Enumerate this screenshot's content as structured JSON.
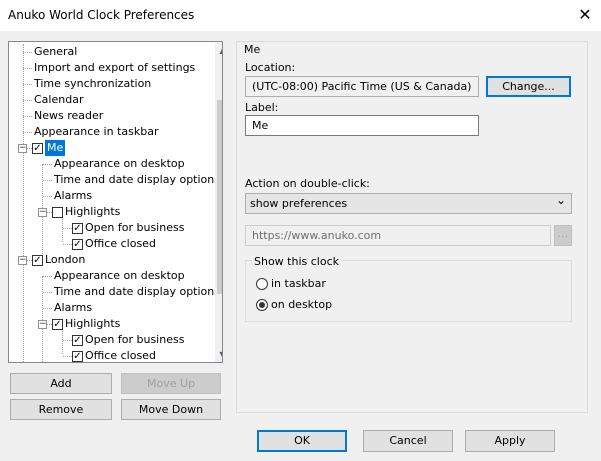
{
  "window": {
    "title": "Anuko World Clock Preferences",
    "close_glyph": "✕"
  },
  "tree": {
    "items": [
      {
        "label": "General"
      },
      {
        "label": "Import and export of settings"
      },
      {
        "label": "Time synchronization"
      },
      {
        "label": "Calendar"
      },
      {
        "label": "News reader"
      },
      {
        "label": "Appearance in taskbar"
      },
      {
        "label": "Me",
        "checked": true,
        "selected": true
      },
      {
        "label": "Appearance on desktop"
      },
      {
        "label": "Time and date display options"
      },
      {
        "label": "Alarms"
      },
      {
        "label": "Highlights",
        "checked": false
      },
      {
        "label": "Open for business",
        "checked": true
      },
      {
        "label": "Office closed",
        "checked": true
      },
      {
        "label": "London",
        "checked": true
      },
      {
        "label": "Appearance on desktop"
      },
      {
        "label": "Time and date display options"
      },
      {
        "label": "Alarms"
      },
      {
        "label": "Highlights",
        "checked": true
      },
      {
        "label": "Open for business",
        "checked": true
      },
      {
        "label": "Office closed",
        "checked": true
      }
    ],
    "check_glyph": "✓",
    "collapse_glyph": "−",
    "scroll_up_glyph": "▲",
    "scroll_down_glyph": "▼"
  },
  "left_buttons": {
    "add": "Add",
    "move_up": "Move Up",
    "remove": "Remove",
    "move_down": "Move Down"
  },
  "panel": {
    "title": "Me",
    "location_label": "Location:",
    "location_value": "(UTC-08:00) Pacific Time (US & Canada)",
    "change_button": "Change...",
    "label_label": "Label:",
    "label_value": "Me",
    "action_label": "Action on double-click:",
    "action_value": "show preferences",
    "dropdown_glyph": "⌄",
    "url_placeholder": "https://www.anuko.com",
    "browse_glyph": "...",
    "show_group_label": "Show this clock",
    "radio_taskbar": "in taskbar",
    "radio_desktop": "on desktop",
    "selected_radio": "on desktop"
  },
  "bottom_buttons": {
    "ok": "OK",
    "cancel": "Cancel",
    "apply": "Apply"
  }
}
